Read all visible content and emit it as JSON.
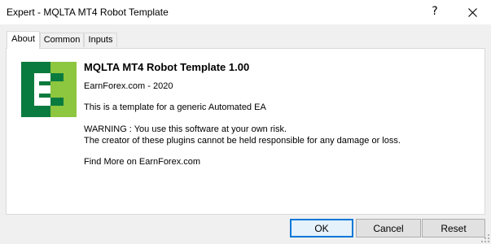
{
  "window": {
    "title": "Expert - MQLTA MT4 Robot Template",
    "help_glyph": "?"
  },
  "tabs": [
    {
      "label": "About",
      "active": true
    },
    {
      "label": "Common",
      "active": false
    },
    {
      "label": "Inputs",
      "active": false
    }
  ],
  "about": {
    "logo_icon": "earnforex-logo-icon",
    "logo_colors": {
      "dark_green": "#0a7b3e",
      "light_green": "#8dc63f"
    },
    "title": "MQLTA MT4 Robot Template 1.00",
    "copyright": "EarnForex.com - 2020",
    "description": "This is a template for a generic Automated EA",
    "warning_line1": "WARNING : You use this software at your own risk.",
    "warning_line2": "The creator of these plugins cannot be held responsible for any damage or loss.",
    "more": "Find More on EarnForex.com"
  },
  "buttons": {
    "ok": "OK",
    "cancel": "Cancel",
    "reset": "Reset"
  },
  "colors": {
    "focus_border": "#0078d7"
  }
}
